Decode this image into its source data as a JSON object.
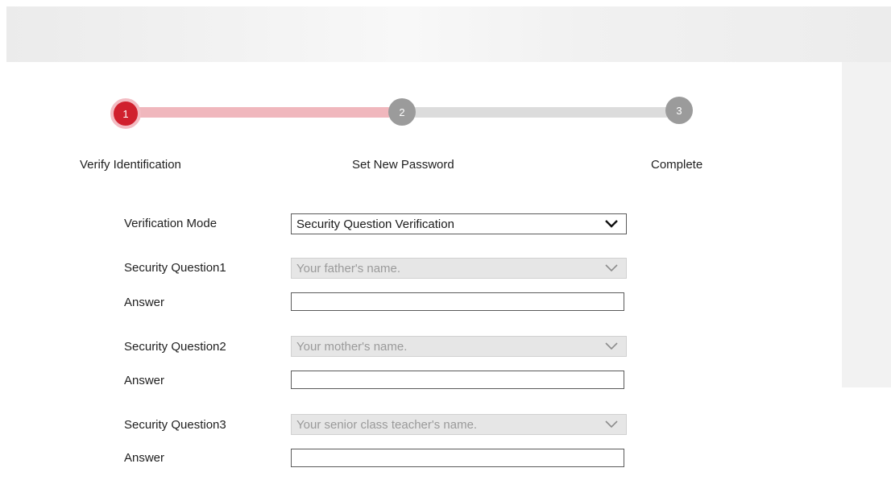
{
  "stepper": {
    "steps": [
      {
        "number": "1",
        "label": "Verify Identification",
        "state": "active"
      },
      {
        "number": "2",
        "label": "Set New Password",
        "state": "pending"
      },
      {
        "number": "3",
        "label": "Complete",
        "state": "pending"
      }
    ],
    "colors": {
      "active": "#d0202e",
      "active_ring": "#f3bcc3",
      "done_track": "#f0b7bd",
      "pending": "#9b9b9b",
      "pending_track": "#dcdcdc"
    }
  },
  "form": {
    "verification_mode": {
      "label": "Verification Mode",
      "value": "Security Question Verification"
    },
    "questions": [
      {
        "label": "Security Question1",
        "value": "Your father's name.",
        "answer_label": "Answer",
        "answer_value": ""
      },
      {
        "label": "Security Question2",
        "value": "Your mother's name.",
        "answer_label": "Answer",
        "answer_value": ""
      },
      {
        "label": "Security Question3",
        "value": "Your senior class teacher's name.",
        "answer_label": "Answer",
        "answer_value": ""
      }
    ]
  },
  "icons": {
    "dropdown": "chevron-down-icon"
  }
}
